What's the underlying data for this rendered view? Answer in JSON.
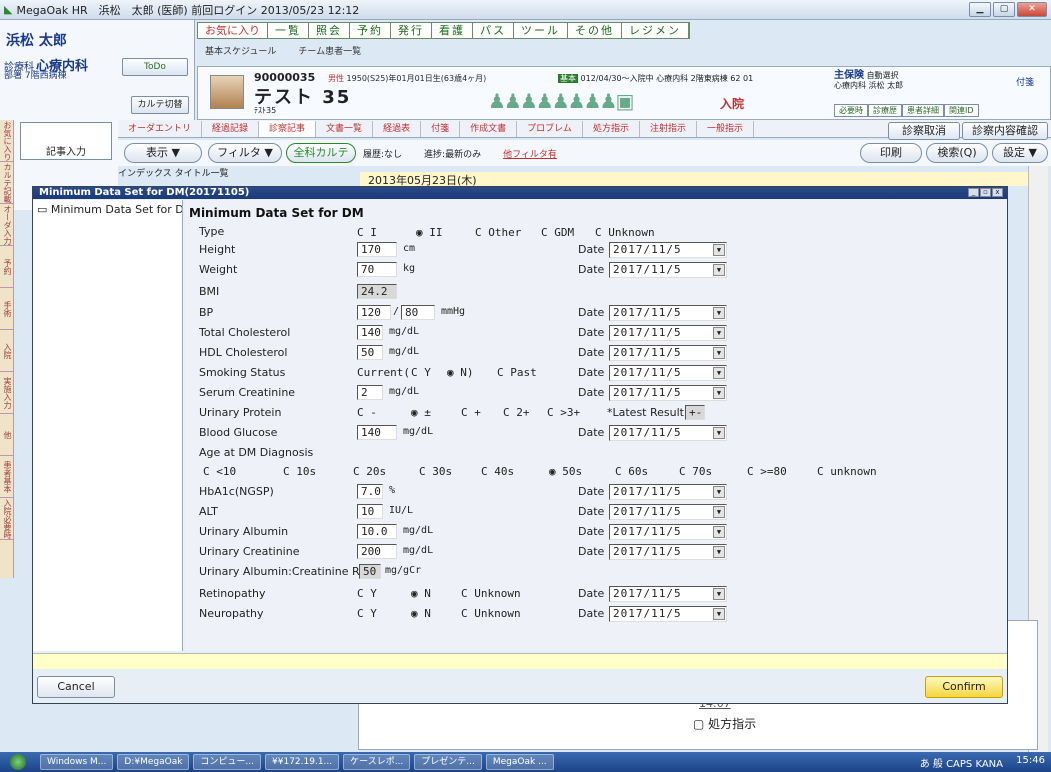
{
  "window": {
    "title": "MegaOak HR　浜松　太郎 (医師) 前回ログイン 2013/05/23 12:12"
  },
  "patient_left": {
    "name": "浜松 太郎",
    "dept_prefix": "診療科",
    "dept": "心療内科",
    "ward_prefix": "部署",
    "ward": "7階西病棟",
    "todo": "ToDo",
    "karte_switch": "カルテ切替"
  },
  "menu": [
    "お気に入り",
    "一覧",
    "照会",
    "予約",
    "発行",
    "看護",
    "パス",
    "ツール",
    "その他",
    "レジメン"
  ],
  "sublinks": [
    "基本スケジュール",
    "チーム患者一覧"
  ],
  "patient": {
    "id": "90000035",
    "kana": "テスト 35",
    "sub": "ﾃｽﾄ35",
    "sex": "男性",
    "birth": "1950(S25)年01月01日生(63歳4ヶ月)",
    "admit_tag": "基本",
    "admit_text": "012/04/30～入院中 心療内科 2階東病棟 62 01",
    "status": "入院",
    "insurance_key": "主保険",
    "insurance": "自動選択",
    "insurance_line2": "心療内科 浜松 太郎",
    "fusen": "付箋",
    "right_tabs": [
      "必要時",
      "診療歴",
      "患者詳細",
      "関連ID"
    ]
  },
  "left_toolbar": {
    "vertical_tabs": [
      "お気に入り",
      "カルテ記載",
      "オーダ入力",
      "予約",
      "手術",
      "入院",
      "実施入力",
      "他",
      "患者基本",
      "入院必要時"
    ],
    "kiroku": "記事入力"
  },
  "tabs": [
    "オーダエントリ",
    "経過記録",
    "診察記事",
    "文書一覧",
    "経過表",
    "付箋",
    "作成文書",
    "プロブレム",
    "処方指示",
    "注射指示",
    "一般指示"
  ],
  "top_buttons": {
    "torikeshi": "診察取消",
    "kakunin": "診察内容確認"
  },
  "toolbar2": {
    "hyoji": "表示 ▼",
    "filter": "フィルタ ▼",
    "allkarte": "全科カルテ",
    "rireki": "履歴:なし",
    "shinryo": "進捗:最新のみ",
    "filter_link": "他フィルタ有",
    "print": "印刷",
    "search": "検索(Q)",
    "settings": "設定 ▼"
  },
  "index_row": "インデックス タイトル一覧",
  "date_row": "2013年05月23日(木)",
  "karte_bg": {
    "time": "14:07",
    "presc": "処方指示"
  },
  "dialog": {
    "title": "Minimum Data Set for DM(20171105)",
    "tree_item": "Minimum Data Set for DM",
    "form_title": "Minimum Data Set for DM",
    "date_label": "Date",
    "type": {
      "label": "Type",
      "options": [
        "C I",
        "C II",
        "C Other",
        "C GDM",
        "C Unknown"
      ],
      "selected": "II"
    },
    "height": {
      "label": "Height",
      "value": "170",
      "unit": "cm",
      "date": "2017/11/5"
    },
    "weight": {
      "label": "Weight",
      "value": "70",
      "unit": "kg",
      "date": "2017/11/5"
    },
    "bmi": {
      "label": "BMI",
      "value": "24.2"
    },
    "bp": {
      "label": "BP",
      "systolic": "120",
      "diastolic": "80",
      "sep": "/",
      "unit": "mmHg",
      "date": "2017/11/5"
    },
    "total_chol": {
      "label": "Total Cholesterol",
      "value": "140",
      "unit": "mg/dL",
      "date": "2017/11/5"
    },
    "hdl": {
      "label": "HDL Cholesterol",
      "value": "50",
      "unit": "mg/dL",
      "date": "2017/11/5"
    },
    "smoking": {
      "label": "Smoking Status",
      "prefix": "Current(",
      "opts": [
        "C Y",
        "◉ N)",
        "C Past"
      ],
      "date": "2017/11/5"
    },
    "creat": {
      "label": "Serum Creatinine",
      "value": "2",
      "unit": "mg/dL",
      "date": "2017/11/5"
    },
    "urine_prot": {
      "label": "Urinary Protein",
      "opts": [
        "C -",
        "◉ ±",
        "C +",
        "C 2+",
        "C >3+"
      ],
      "latest_label": "*Latest Result",
      "latest": "+-"
    },
    "glucose": {
      "label": "Blood Glucose",
      "value": "140",
      "unit": "mg/dL",
      "date": "2017/11/5"
    },
    "age_dx": {
      "label": "Age at DM Diagnosis",
      "opts": [
        "C <10",
        "C 10s",
        "C 20s",
        "C 30s",
        "C 40s",
        "◉ 50s",
        "C 60s",
        "C 70s",
        "C >=80",
        "C unknown"
      ]
    },
    "hba1c": {
      "label": "HbA1c(NGSP)",
      "value": "7.0",
      "unit": "%",
      "date": "2017/11/5"
    },
    "alt": {
      "label": "ALT",
      "value": "10",
      "unit": "IU/L",
      "date": "2017/11/5"
    },
    "u_alb": {
      "label": "Urinary Albumin",
      "value": "10.0",
      "unit": "mg/dL",
      "date": "2017/11/5"
    },
    "u_creat": {
      "label": "Urinary Creatinine",
      "value": "200",
      "unit": "mg/dL",
      "date": "2017/11/5"
    },
    "alb_ratio": {
      "label": "Urinary Albumin:Creatinine Ratio",
      "value": "50",
      "unit": "mg/gCr"
    },
    "retinopathy": {
      "label": "Retinopathy",
      "opts": [
        "C Y",
        "◉ N",
        "C Unknown"
      ],
      "date": "2017/11/5"
    },
    "neuropathy": {
      "label": "Neuropathy",
      "opts": [
        "C Y",
        "◉ N",
        "C Unknown"
      ],
      "date": "2017/11/5"
    },
    "cancel": "Cancel",
    "confirm": "Confirm"
  },
  "taskbar": {
    "items": [
      "Windows M...",
      "D:¥MegaOak",
      "コンピュー...",
      "¥¥172.19.1...",
      "ケースレポ...",
      "プレゼンテ...",
      "MegaOak ..."
    ],
    "tray": "あ 般 CAPS KANA",
    "clock": "15:46"
  }
}
